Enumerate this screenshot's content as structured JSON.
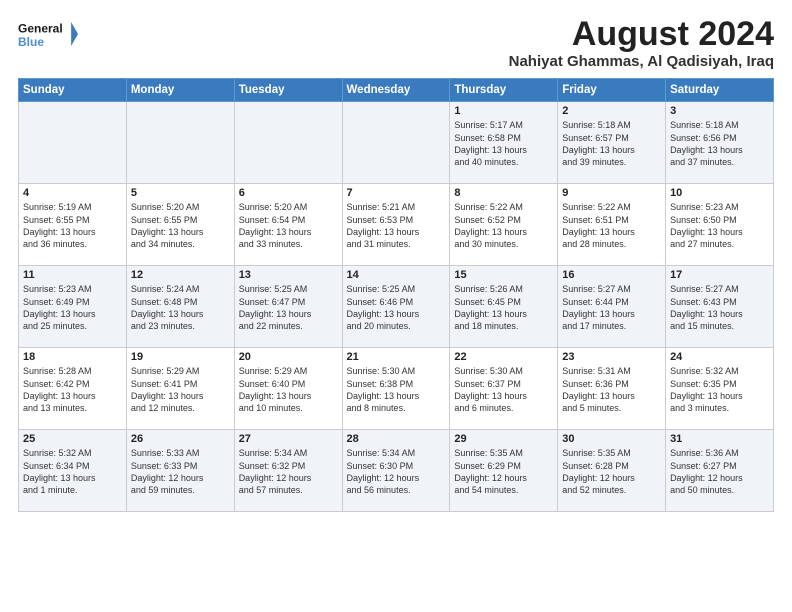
{
  "logo": {
    "line1": "General",
    "line2": "Blue"
  },
  "title": "August 2024",
  "subtitle": "Nahiyat Ghammas, Al Qadisiyah, Iraq",
  "weekdays": [
    "Sunday",
    "Monday",
    "Tuesday",
    "Wednesday",
    "Thursday",
    "Friday",
    "Saturday"
  ],
  "weeks": [
    [
      {
        "day": "",
        "info": ""
      },
      {
        "day": "",
        "info": ""
      },
      {
        "day": "",
        "info": ""
      },
      {
        "day": "",
        "info": ""
      },
      {
        "day": "1",
        "info": "Sunrise: 5:17 AM\nSunset: 6:58 PM\nDaylight: 13 hours\nand 40 minutes."
      },
      {
        "day": "2",
        "info": "Sunrise: 5:18 AM\nSunset: 6:57 PM\nDaylight: 13 hours\nand 39 minutes."
      },
      {
        "day": "3",
        "info": "Sunrise: 5:18 AM\nSunset: 6:56 PM\nDaylight: 13 hours\nand 37 minutes."
      }
    ],
    [
      {
        "day": "4",
        "info": "Sunrise: 5:19 AM\nSunset: 6:55 PM\nDaylight: 13 hours\nand 36 minutes."
      },
      {
        "day": "5",
        "info": "Sunrise: 5:20 AM\nSunset: 6:55 PM\nDaylight: 13 hours\nand 34 minutes."
      },
      {
        "day": "6",
        "info": "Sunrise: 5:20 AM\nSunset: 6:54 PM\nDaylight: 13 hours\nand 33 minutes."
      },
      {
        "day": "7",
        "info": "Sunrise: 5:21 AM\nSunset: 6:53 PM\nDaylight: 13 hours\nand 31 minutes."
      },
      {
        "day": "8",
        "info": "Sunrise: 5:22 AM\nSunset: 6:52 PM\nDaylight: 13 hours\nand 30 minutes."
      },
      {
        "day": "9",
        "info": "Sunrise: 5:22 AM\nSunset: 6:51 PM\nDaylight: 13 hours\nand 28 minutes."
      },
      {
        "day": "10",
        "info": "Sunrise: 5:23 AM\nSunset: 6:50 PM\nDaylight: 13 hours\nand 27 minutes."
      }
    ],
    [
      {
        "day": "11",
        "info": "Sunrise: 5:23 AM\nSunset: 6:49 PM\nDaylight: 13 hours\nand 25 minutes."
      },
      {
        "day": "12",
        "info": "Sunrise: 5:24 AM\nSunset: 6:48 PM\nDaylight: 13 hours\nand 23 minutes."
      },
      {
        "day": "13",
        "info": "Sunrise: 5:25 AM\nSunset: 6:47 PM\nDaylight: 13 hours\nand 22 minutes."
      },
      {
        "day": "14",
        "info": "Sunrise: 5:25 AM\nSunset: 6:46 PM\nDaylight: 13 hours\nand 20 minutes."
      },
      {
        "day": "15",
        "info": "Sunrise: 5:26 AM\nSunset: 6:45 PM\nDaylight: 13 hours\nand 18 minutes."
      },
      {
        "day": "16",
        "info": "Sunrise: 5:27 AM\nSunset: 6:44 PM\nDaylight: 13 hours\nand 17 minutes."
      },
      {
        "day": "17",
        "info": "Sunrise: 5:27 AM\nSunset: 6:43 PM\nDaylight: 13 hours\nand 15 minutes."
      }
    ],
    [
      {
        "day": "18",
        "info": "Sunrise: 5:28 AM\nSunset: 6:42 PM\nDaylight: 13 hours\nand 13 minutes."
      },
      {
        "day": "19",
        "info": "Sunrise: 5:29 AM\nSunset: 6:41 PM\nDaylight: 13 hours\nand 12 minutes."
      },
      {
        "day": "20",
        "info": "Sunrise: 5:29 AM\nSunset: 6:40 PM\nDaylight: 13 hours\nand 10 minutes."
      },
      {
        "day": "21",
        "info": "Sunrise: 5:30 AM\nSunset: 6:38 PM\nDaylight: 13 hours\nand 8 minutes."
      },
      {
        "day": "22",
        "info": "Sunrise: 5:30 AM\nSunset: 6:37 PM\nDaylight: 13 hours\nand 6 minutes."
      },
      {
        "day": "23",
        "info": "Sunrise: 5:31 AM\nSunset: 6:36 PM\nDaylight: 13 hours\nand 5 minutes."
      },
      {
        "day": "24",
        "info": "Sunrise: 5:32 AM\nSunset: 6:35 PM\nDaylight: 13 hours\nand 3 minutes."
      }
    ],
    [
      {
        "day": "25",
        "info": "Sunrise: 5:32 AM\nSunset: 6:34 PM\nDaylight: 13 hours\nand 1 minute."
      },
      {
        "day": "26",
        "info": "Sunrise: 5:33 AM\nSunset: 6:33 PM\nDaylight: 12 hours\nand 59 minutes."
      },
      {
        "day": "27",
        "info": "Sunrise: 5:34 AM\nSunset: 6:32 PM\nDaylight: 12 hours\nand 57 minutes."
      },
      {
        "day": "28",
        "info": "Sunrise: 5:34 AM\nSunset: 6:30 PM\nDaylight: 12 hours\nand 56 minutes."
      },
      {
        "day": "29",
        "info": "Sunrise: 5:35 AM\nSunset: 6:29 PM\nDaylight: 12 hours\nand 54 minutes."
      },
      {
        "day": "30",
        "info": "Sunrise: 5:35 AM\nSunset: 6:28 PM\nDaylight: 12 hours\nand 52 minutes."
      },
      {
        "day": "31",
        "info": "Sunrise: 5:36 AM\nSunset: 6:27 PM\nDaylight: 12 hours\nand 50 minutes."
      }
    ]
  ]
}
